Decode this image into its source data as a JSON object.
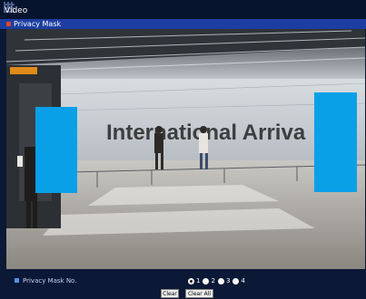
{
  "window": {
    "title": "Video"
  },
  "section": {
    "title": "Privacy Mask"
  },
  "video": {
    "scene_sign_text": "International Arriva",
    "mask_color": "#0aa0e8"
  },
  "controls": {
    "mask_no_label": "Privacy Mask No.",
    "options": [
      "1",
      "2",
      "3",
      "4"
    ],
    "selected_option": "1",
    "clear_label": "Clear",
    "clear_all_label": "Clear All"
  },
  "colors": {
    "titlebar": "#07142e",
    "subbar": "#1c3ea1",
    "background": "#0b1836"
  }
}
